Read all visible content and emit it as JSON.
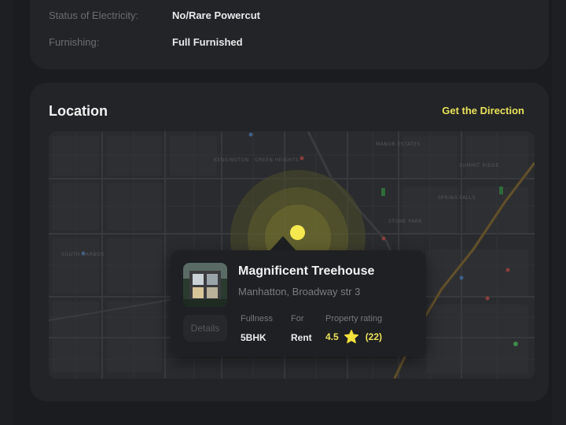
{
  "details": {
    "rows": [
      {
        "label": "Status of Electricity:",
        "value": "No/Rare Powercut"
      },
      {
        "label": "Furnishing:",
        "value": "Full Furnished"
      }
    ]
  },
  "location": {
    "title": "Location",
    "direction_link": "Get the Direction",
    "map_labels": [
      "KENSINGTON",
      "GREEN HEIGHTS",
      "SOUTH HARBOR",
      "MANOR ESTATES",
      "SUMMIT RIDGE",
      "SPRING FALLS",
      "STONE PARK"
    ]
  },
  "popup": {
    "title": "Magnificent Treehouse",
    "address": "Manhatton, Broadway str 3",
    "details_button": "Details",
    "fullness_label": "Fullness",
    "fullness_value": "5BHK",
    "for_label": "For",
    "for_value": "Rent",
    "rating_label": "Property rating",
    "rating_value": "4.5",
    "rating_count": "(22)",
    "star_icon": "star-icon"
  },
  "colors": {
    "accent": "#e8e25a",
    "background": "#1b1c1f",
    "card": "#232427"
  }
}
